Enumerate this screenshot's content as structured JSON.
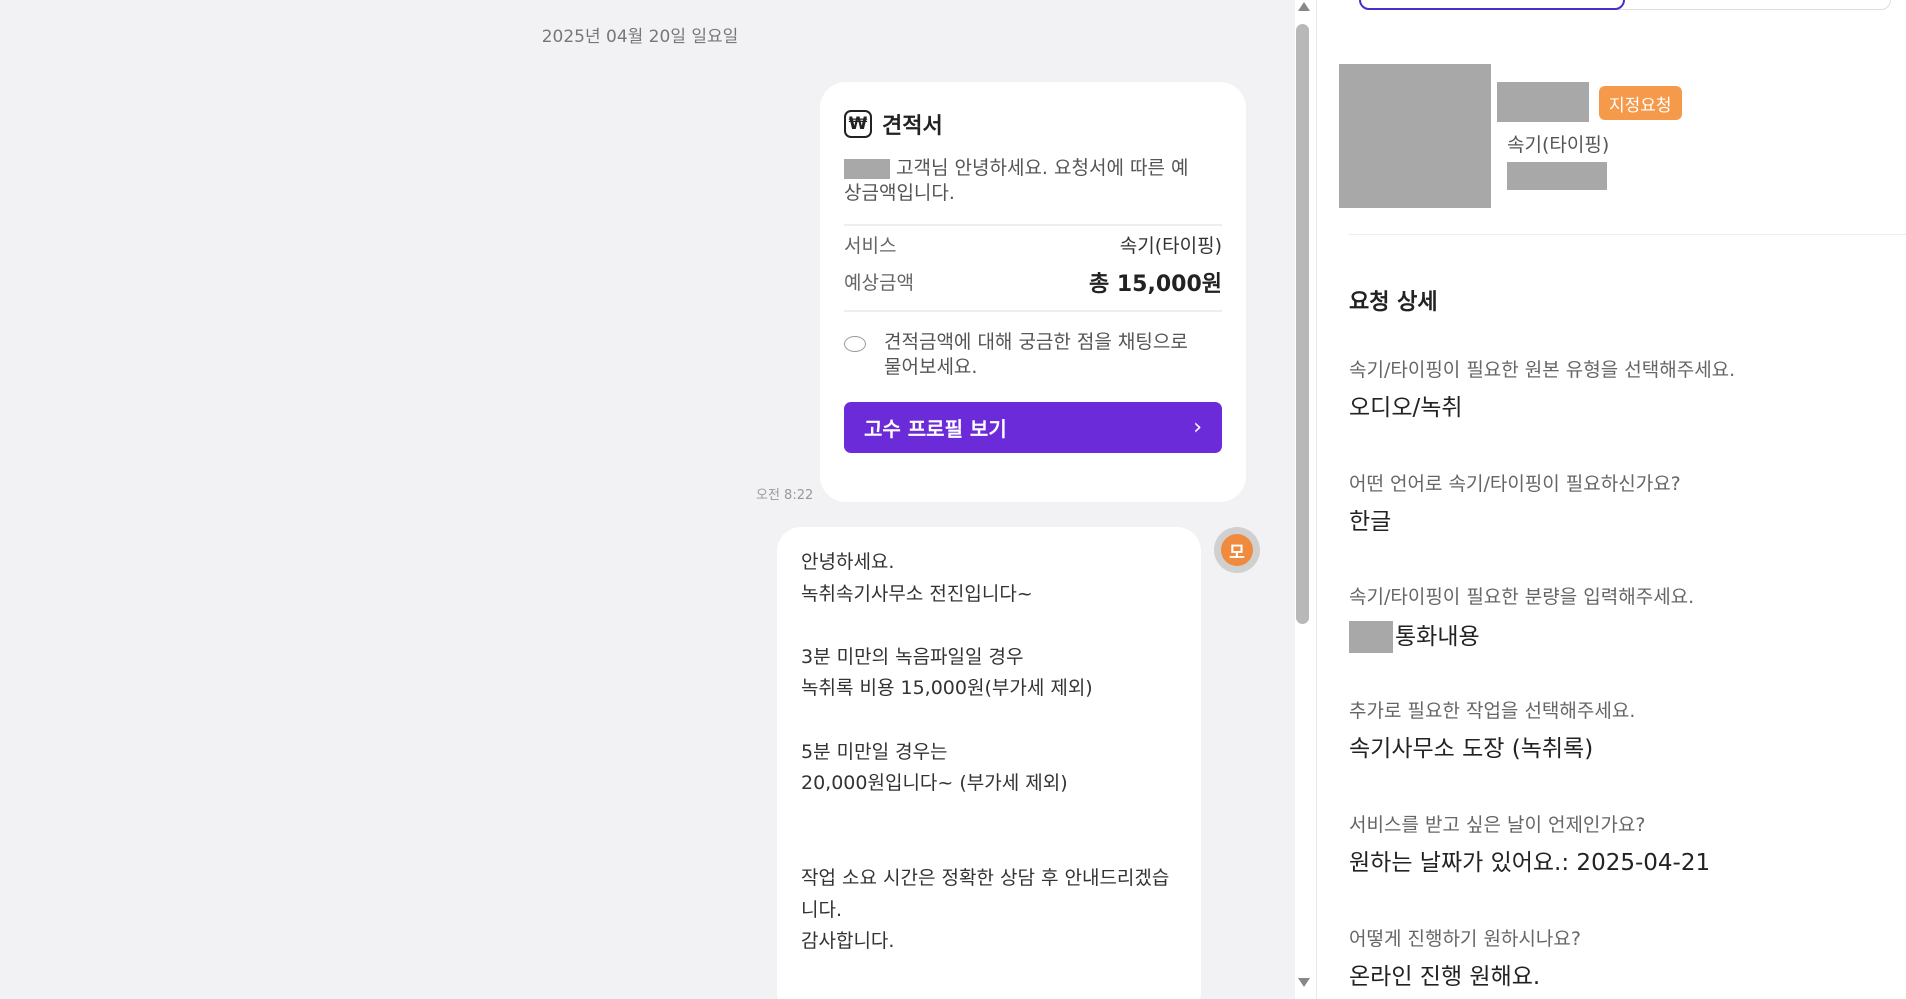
{
  "chat": {
    "date": "2025년 04월 20일 일요일",
    "quote": {
      "icon": "won-icon",
      "icon_glyph": "₩",
      "title": "견적서",
      "greeting_line1": "고객님 안녕하세요. 요청서에 따른 예",
      "greeting_line2": "상금액입니다.",
      "service_label": "서비스",
      "service_value": "속기(타이핑)",
      "amount_label": "예상금액",
      "amount_value": "총 15,000원",
      "hint_line1": "견적금액에 대해 궁금한 점을 채팅으로",
      "hint_line2": "물어보세요.",
      "button_label": "고수 프로필 보기",
      "button_chevron": "›",
      "time": "오전 8:22"
    },
    "message_lines": [
      "안녕하세요.",
      "녹취속기사무소 전진입니다~",
      "",
      "3분 미만의 녹음파일일 경우",
      "녹취록 비용 15,000원(부가세 제외)",
      "",
      "5분 미만일 경우는",
      "20,000원입니다~ (부가세 제외)",
      "",
      "",
      "작업 소요 시간은 정확한 상담 후 안내드리겠습",
      "니다.",
      "감사합니다."
    ],
    "avatar_glyph": "모"
  },
  "info": {
    "badge": "지정요청",
    "service": "속기(타이핑)",
    "section_title": "요청 상세",
    "qa": [
      {
        "q": "속기/타이핑이 필요한 원본 유형을 선택해주세요.",
        "a": "오디오/녹취"
      },
      {
        "q": "어떤 언어로 속기/타이핑이 필요하신가요?",
        "a": "한글"
      },
      {
        "q": "속기/타이핑이 필요한 분량을 입력해주세요.",
        "a": "통화내용"
      },
      {
        "q": "추가로 필요한 작업을 선택해주세요.",
        "a": "속기사무소 도장 (녹취록)"
      },
      {
        "q": "서비스를 받고 싶은 날이 언제인가요?",
        "a": "원하는 날짜가 있어요.: 2025-04-21"
      },
      {
        "q": "어떻게 진행하기 원하시나요?",
        "a": "온라인 진행 원해요."
      }
    ]
  },
  "colors": {
    "accent": "#6c2bd9",
    "badge": "#f59a4b",
    "chat_bg": "#f2f2f4"
  }
}
